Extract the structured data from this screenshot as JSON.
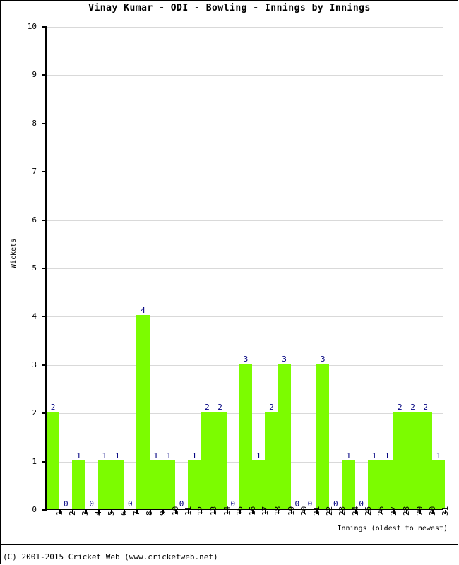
{
  "chart_data": {
    "type": "bar",
    "title": "Vinay Kumar - ODI - Bowling - Innings by Innings",
    "xlabel": "Innings (oldest to newest)",
    "ylabel": "Wickets",
    "ylim": [
      0,
      10
    ],
    "ytick_labels": [
      "0",
      "1",
      "2",
      "3",
      "4",
      "5",
      "6",
      "7",
      "8",
      "9",
      "10"
    ],
    "yticks": [
      0,
      1,
      2,
      3,
      4,
      5,
      6,
      7,
      8,
      9,
      10
    ],
    "grid": true,
    "legend": null,
    "bar_color": "#7CFC00",
    "label_color": "#000080",
    "gridline_color": "#D9D9D9",
    "axis_color": "#000000",
    "categories": [
      "1",
      "2",
      "3",
      "4",
      "5",
      "6",
      "7",
      "8",
      "9",
      "10",
      "11",
      "12",
      "13",
      "14",
      "15",
      "16",
      "17",
      "18",
      "19",
      "20",
      "21",
      "22",
      "23",
      "24",
      "25",
      "26",
      "27",
      "28",
      "29",
      "30",
      "31"
    ],
    "values": [
      2,
      0,
      1,
      0,
      1,
      1,
      0,
      4,
      1,
      1,
      0,
      1,
      2,
      2,
      0,
      3,
      1,
      2,
      3,
      0,
      0,
      3,
      0,
      1,
      0,
      1,
      1,
      2,
      2,
      2,
      1
    ],
    "data_labels": [
      "2",
      "0",
      "1",
      "0",
      "1",
      "1",
      "0",
      "4",
      "1",
      "1",
      "0",
      "1",
      "2",
      "2",
      "0",
      "3",
      "1",
      "2",
      "3",
      "0",
      "0",
      "3",
      "0",
      "1",
      "0",
      "1",
      "1",
      "2",
      "2",
      "2",
      "1"
    ]
  },
  "footer": {
    "copyright": "(C) 2001-2015 Cricket Web (www.cricketweb.net)"
  }
}
